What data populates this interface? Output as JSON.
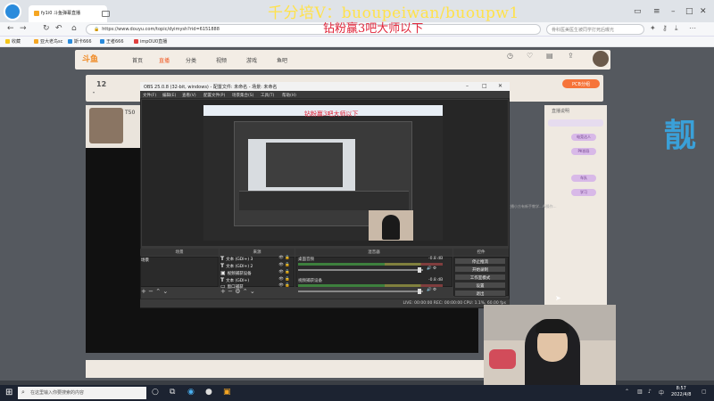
{
  "overlay": {
    "contact": "千分培V：buoupeiwan/buoupw1",
    "slogan": "钻粉赢3吧大师以下",
    "nested_slogan": "钻粉赢3吧大师以下"
  },
  "browser": {
    "tab_title": "fy1i0 斗鱼弹幕直播",
    "url": "https://www.douyu.com/topic/dyimysh?rid=6151888",
    "search_placeholder": "骨科医美医生被同学打死后曝光",
    "bookmarks": [
      "收藏",
      "亚大老鸟sc",
      "斯卡666",
      "王者666",
      "impOU0直播"
    ]
  },
  "douyu": {
    "logo": "斗鱼",
    "nav": [
      "首页",
      "直播",
      "分类",
      "视频",
      "游戏",
      "鱼吧"
    ],
    "rank_number": "12",
    "player_id": "T50",
    "pcb_badge": "PCB分组",
    "side_title": "直播说明",
    "side_tags": [
      "电竞达人",
      "PK领导",
      "车队",
      "学习"
    ],
    "side_text": "主播小方有新手教学...Ai操作..."
  },
  "obs": {
    "title": "OBS 25.0.8 (32-bit, windows) - 配置文件: 未命名 - 场景: 未命名",
    "menu": [
      "文件(F)",
      "编辑(E)",
      "查看(V)",
      "配置文件(P)",
      "场景集合(S)",
      "工具(T)",
      "帮助(H)"
    ],
    "docks": {
      "scenes": "场景",
      "sources": "来源",
      "mixer": "混音器",
      "controls": "控件"
    },
    "scene_name": "场景",
    "sources": [
      {
        "name": "文本 (GDI+) 3"
      },
      {
        "name": "文本 (GDI+) 2"
      },
      {
        "name": "视频捕获设备"
      },
      {
        "name": "文本 (GDI+)"
      },
      {
        "name": "窗口捕获"
      }
    ],
    "mixer": [
      {
        "label": "桌面音频",
        "db": "-0.8 dB"
      },
      {
        "label": "视频捕获设备",
        "db": "-0.8 dB"
      }
    ],
    "controls": [
      "停止推流",
      "开始录制",
      "工作室模式",
      "设置",
      "退出"
    ],
    "status": "LIVE: 00:00:00   REC: 00:00:00   CPU: 1.1%, 60.00 fps"
  },
  "taskbar": {
    "search_placeholder": "在这里输入你要搜索的内容",
    "time": "8:57",
    "date": "2022/4/8"
  }
}
